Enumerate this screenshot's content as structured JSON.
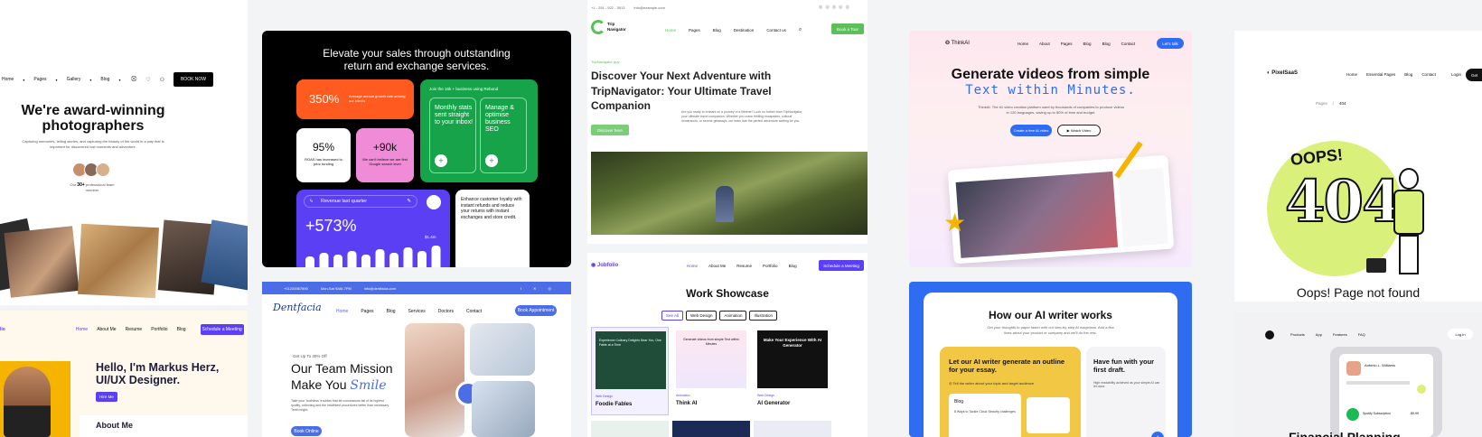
{
  "photo": {
    "nav": [
      "Home",
      "Pages",
      "Gallery",
      "Blog"
    ],
    "book_button": "BOOK NOW",
    "headline": "We're award-winning photographers",
    "subtext": "Capturing memories, telling stories, and capturing the beauty of the world in a way that is important for discovered lost moments and adventure.",
    "members_prefix": "Our",
    "members_count": "30+",
    "members_suffix": "professional team member"
  },
  "portfolio": {
    "logo": "lio",
    "nav": [
      "Home",
      "About Me",
      "Resume",
      "Portfolio",
      "Blog"
    ],
    "schedule_button": "Schedule a Meeting",
    "headline": "Hello, I'm Markus Herz, UI/UX Designer.",
    "hire_button": "Hire Me",
    "about_title": "About Me"
  },
  "sales": {
    "headline": "Elevate your sales through outstanding return and exchange services.",
    "stat1_value": "350%",
    "stat1_text": "Average annual growth rate among our clients",
    "join_text": "Join the 16k + business using Rebond",
    "tile_monthly": "Monthly stats sent straight to your inbox!",
    "tile_manage": "Manage & optimise business SEO",
    "stat2_value": "95%",
    "stat2_text": "ROAS has increased to prior funding",
    "stat3_value": "+90k",
    "stat3_text": "We can't believe we are first Google search level",
    "revenue_label": "Revenue last quarter",
    "revenue_value": "+573%",
    "revenue_small": "$1.4m",
    "enhance_text": "Enhance customer loyalty with instant refunds and reduce your returns with instant exchanges and store credit."
  },
  "dental": {
    "top_phone": "+01234567890",
    "top_hours": "Mon-Sat 9AM-7PM",
    "top_email": "info@dentfacia.com",
    "logo": "Dentfacia",
    "nav": [
      "Home",
      "Pages",
      "Blog",
      "Services",
      "Doctors",
      "Contact"
    ],
    "appointment_button": "Book Appointment",
    "discount": "Get Up To 30% Off",
    "headline_1": "Our Team Mission",
    "headline_2": "Make You",
    "headline_smile": "Smile",
    "body": "Take your 'toothless' troubles that let concessions fail of its highest quality, collecting and the healthiest procedures better than necessary. Teeth bright.",
    "book_button": "Book Online"
  },
  "trip": {
    "top_phone": "+1 - 251 - 522 - 3913",
    "top_email": "info@example.com",
    "logo_1": "Trip",
    "logo_2": "Navigator",
    "nav": [
      "Home",
      "Pages",
      "Blog",
      "Destination",
      "Contact us"
    ],
    "book_button": "Book a Tour",
    "eyebrow": "TripNavigator guy",
    "headline": "Discover Your Next Adventure with TripNavigator: Your Ultimate Travel Companion",
    "cta": "Discover here",
    "body": "Are you ready to embark on a journey of a lifetime? Look no further than TripNavigator, your ultimate travel companion. Whether you crave thrilling escapades, cultural immersions, or serene getaways, our team has the perfect adventure waiting for you."
  },
  "jobfolio": {
    "logo": "Jobfolio",
    "nav": [
      "Home",
      "About Me",
      "Resume",
      "Portfolio",
      "Blog"
    ],
    "schedule_button": "Schedule a Meeting",
    "title": "Work Showcase",
    "filters": [
      "See All",
      "Web Design",
      "Animation",
      "Illustration"
    ],
    "items": [
      {
        "category": "Web Design",
        "title": "Foodie Fables",
        "screen": "Experience Culinary Delights Near You, One Fable at a Time"
      },
      {
        "category": "Animation",
        "title": "Think AI",
        "screen": "Generate videos from simple Text within Minutes"
      },
      {
        "category": "Web Design",
        "title": "AI Generator",
        "screen": "Make Your Experience With AI Generator"
      }
    ]
  },
  "thinkai": {
    "logo": "ThinkAI",
    "nav": [
      "Home",
      "About",
      "Pages",
      "Blog",
      "Blog",
      "Contact"
    ],
    "cta_button": "Let's talk",
    "headline": "Generate videos from simple",
    "headline_accent": "Text within Minutes.",
    "body": "ThinkAI: The #1 video creation platform used by thousands of companies to produce videos in 120 languages, saving up to 80% of time and budget.",
    "primary_button": "Create a free AI video",
    "secondary_button": "Watch Video"
  },
  "writer": {
    "title": "How our AI writer works",
    "subtitle": "Get your thoughts to paper faster with our step-by-step AI magicians. Add a few lines about your product or company and we'll do the rest.",
    "step1_title": "Let our AI writer generate an outline for your essay.",
    "step1_text": "Tell the writer about your topic and target audience",
    "step2_title": "Have fun with your first draft.",
    "step2_text": "High readability achieved as your simple AI can let done",
    "doc_label": "Blog",
    "doc_item": "8 Ways to Tackle Cloud Security challenges"
  },
  "pixel": {
    "logo": "PixelSaaS",
    "nav": [
      "Home",
      "Essential Pages",
      "Blog",
      "Contact"
    ],
    "login": "Login",
    "get_started": "Get",
    "breadcrumb_1": "Pages",
    "breadcrumb_sep": "/",
    "breadcrumb_2": "404",
    "oops": "OOPS!",
    "code": "404",
    "message": "Oops! Page not found"
  },
  "finance": {
    "nav": [
      "Products",
      "App",
      "Features",
      "FAQ"
    ],
    "login": "Log In",
    "person": "Antonio L. Williams",
    "item": "Spotify Subscription",
    "amount": "-$9.99",
    "title": "Financial Planning"
  },
  "colors": {
    "orange": "#ff5a1f",
    "green": "#16a34a",
    "purple": "#5b3ff5",
    "blue": "#2f6cf2",
    "yellow": "#f2c744",
    "lime": "#d9f07a"
  }
}
